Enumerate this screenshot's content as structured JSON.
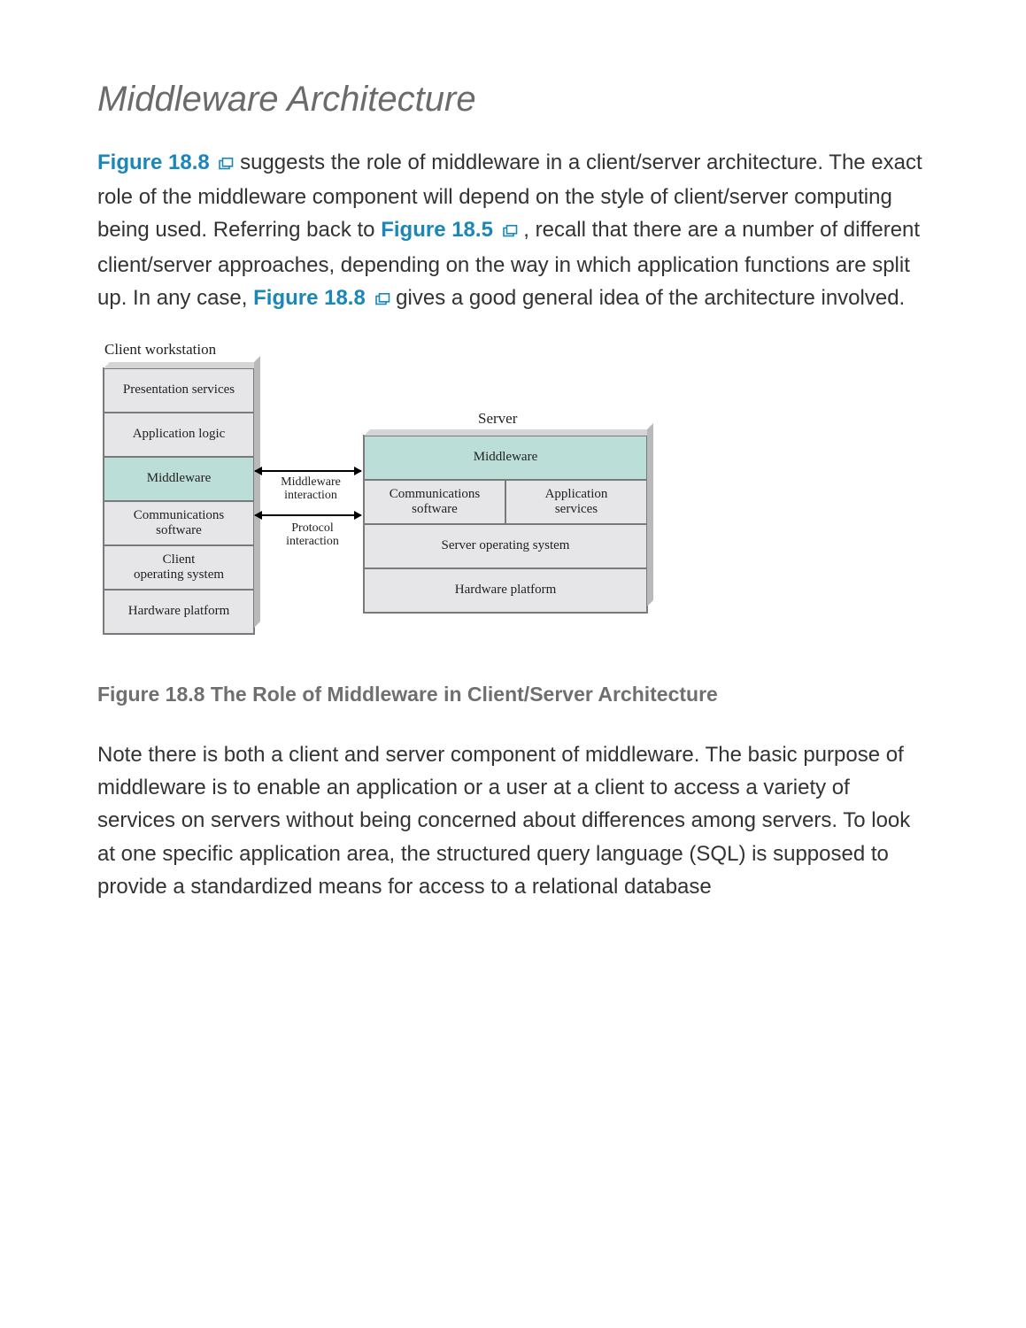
{
  "heading": "Middleware Architecture",
  "paragraph1": {
    "ref1": "Figure 18.8",
    "t1": " suggests the role of middleware in a client/server architecture. The exact role of the middleware component will depend on the style of client/server computing being used. Referring back to ",
    "ref2": "Figure 18.5",
    "t2": ", recall that there are a number of different client/server approaches, depending on the way in which application functions are split up. In any case, ",
    "ref3": "Figure 18.8",
    "t3": " gives a good general idea of the architecture involved."
  },
  "diagram": {
    "client_label": "Client workstation",
    "server_label": "Server",
    "client_layers": {
      "presentation": "Presentation services",
      "applogic": "Application logic",
      "middleware": "Middleware",
      "comm": "Communications\nsoftware",
      "os": "Client\noperating system",
      "hw": "Hardware platform"
    },
    "server_layers": {
      "middleware": "Middleware",
      "comm": "Communications\nsoftware",
      "appsvc": "Application\nservices",
      "os": "Server operating system",
      "hw": "Hardware platform"
    },
    "interaction": {
      "middleware": "Middleware\ninteraction",
      "protocol": "Protocol\ninteraction"
    }
  },
  "caption": "Figure 18.8 The Role of Middleware in Client/Server Architecture",
  "paragraph2": "Note there is both a client and server component of middleware. The basic purpose of middleware is to enable an application or a user at a client to access a variety of services on servers without being concerned about differences among servers. To look at one specific application area, the structured query language (SQL) is supposed to provide a standardized means for access to a relational database"
}
